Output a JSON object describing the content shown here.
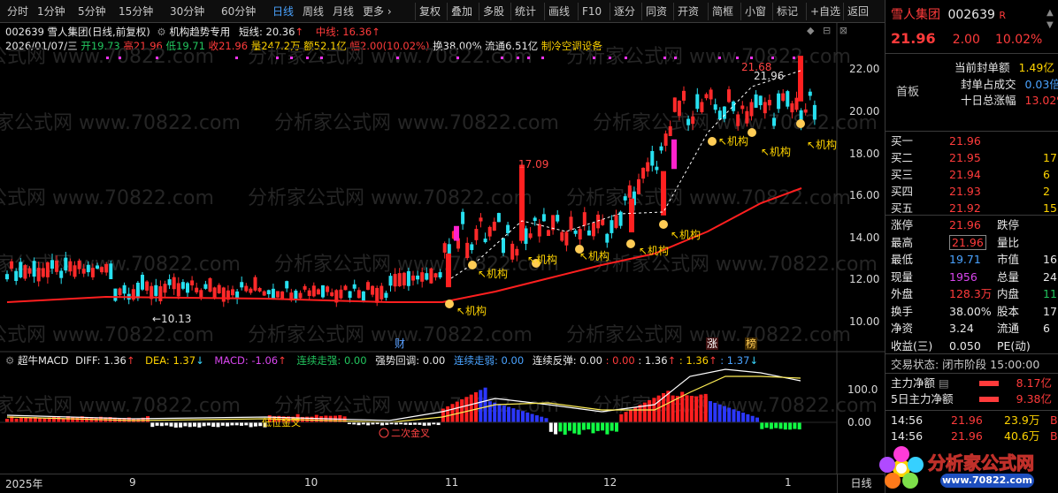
{
  "toolbar": {
    "left": [
      "分时",
      "1分钟",
      "5分钟",
      "15分钟",
      "30分钟",
      "60分钟",
      "日线",
      "周线",
      "月线",
      "更多 ›"
    ],
    "active": "日线",
    "right": [
      "复权",
      "叠加",
      "多股",
      "统计",
      "画线",
      "F10",
      "逐分",
      "同资",
      "开资",
      "简框",
      "小窗",
      "标记",
      "+自选",
      "返回"
    ]
  },
  "header": {
    "line1": {
      "code_name": "002639 雪人集团(日线,前复权)",
      "indicator": "机构趋势专用",
      "short_label": "短线: 20.36",
      "mid_label": "中线: 16.36"
    },
    "line2": {
      "date": "2026/01/07/三",
      "open": "开19.73",
      "high": "高21.96",
      "low": "低19.71",
      "close": "收21.96",
      "vol": "量247.2万",
      "amount": "额52.1亿",
      "change": "幅2.00(10.02%)",
      "turnover": "换38.00%",
      "float": "流通6.51亿",
      "sector": "制冷空调设备"
    }
  },
  "watermark": "分析家公式网 www.70822.com",
  "price_axis": [
    "22.00",
    "20.00",
    "18.00",
    "16.00",
    "14.00",
    "12.00",
    "10.00"
  ],
  "annotations": {
    "high1": "21.68",
    "high2": "21.96",
    "peak": "17.09",
    "low": "←10.13",
    "jigou": "机构",
    "cai": "财",
    "zhang": "涨",
    "bang": "榜"
  },
  "macd": {
    "title": "超牛MACD",
    "diff": "DIFF: 1.36",
    "dea": "DEA: 1.37",
    "macd": "MACD: -1.06",
    "lx": "连续走强: 0.00",
    "qs": "强势回调: 0.00",
    "lr": "连续走弱: 0.00",
    "fx": "连续反弹: 0.00",
    "v1": ": 0.00",
    "v2": ": 1.36",
    "v3": ": 1.36",
    "v4": ": 1.37",
    "axis": [
      "100.0",
      "0.00"
    ],
    "label1": "低位金叉",
    "label2": "二次金叉"
  },
  "time_axis": [
    "2025年",
    "9",
    "10",
    "11",
    "12",
    "1"
  ],
  "period": "日线",
  "quote": {
    "name": "雪人集团",
    "code": "002639",
    "flag": "R",
    "price": "21.96",
    "change": "2.00",
    "pct": "10.02%",
    "board": "首板",
    "seal_label": "当前封单额",
    "seal_val": "1.49亿",
    "seal_ratio_label": "封单占成交",
    "seal_ratio_val": "0.03倍",
    "ten_label": "十日总涨幅",
    "ten_val": "13.02%",
    "book": [
      {
        "label": "买一",
        "price": "21.96",
        "vol": ""
      },
      {
        "label": "买二",
        "price": "21.95",
        "vol": "17"
      },
      {
        "label": "买三",
        "price": "21.94",
        "vol": "6"
      },
      {
        "label": "买四",
        "price": "21.93",
        "vol": "2"
      },
      {
        "label": "买五",
        "price": "21.92",
        "vol": "15"
      }
    ],
    "stats": [
      [
        "涨停",
        "21.96",
        "跌停",
        ""
      ],
      [
        "最高",
        "21.96",
        "量比",
        ""
      ],
      [
        "最低",
        "19.71",
        "市值",
        "16"
      ],
      [
        "现量",
        "1956",
        "总量",
        "24"
      ],
      [
        "外盘",
        "128.3万",
        "内盘",
        "11"
      ],
      [
        "换手",
        "38.00%",
        "股本",
        "17"
      ],
      [
        "净资",
        "3.24",
        "流通",
        "6"
      ],
      [
        "收益(三)",
        "0.050",
        "PE(动)",
        ""
      ]
    ],
    "status": "交易状态: 闭市阶段 15:00:00",
    "flow1_label": "主力净额",
    "flow1_val": "8.17亿",
    "flow2_label": "5日主力净额",
    "flow2_val": "9.38亿",
    "ticks": [
      {
        "time": "14:56",
        "price": "21.96",
        "vol": "23.9万",
        "dir": "B"
      },
      {
        "time": "14:56",
        "price": "21.96",
        "vol": "40.6万",
        "dir": "B"
      }
    ],
    "logo_text": "分析家公式网",
    "logo_url": "www.70822.com"
  }
}
